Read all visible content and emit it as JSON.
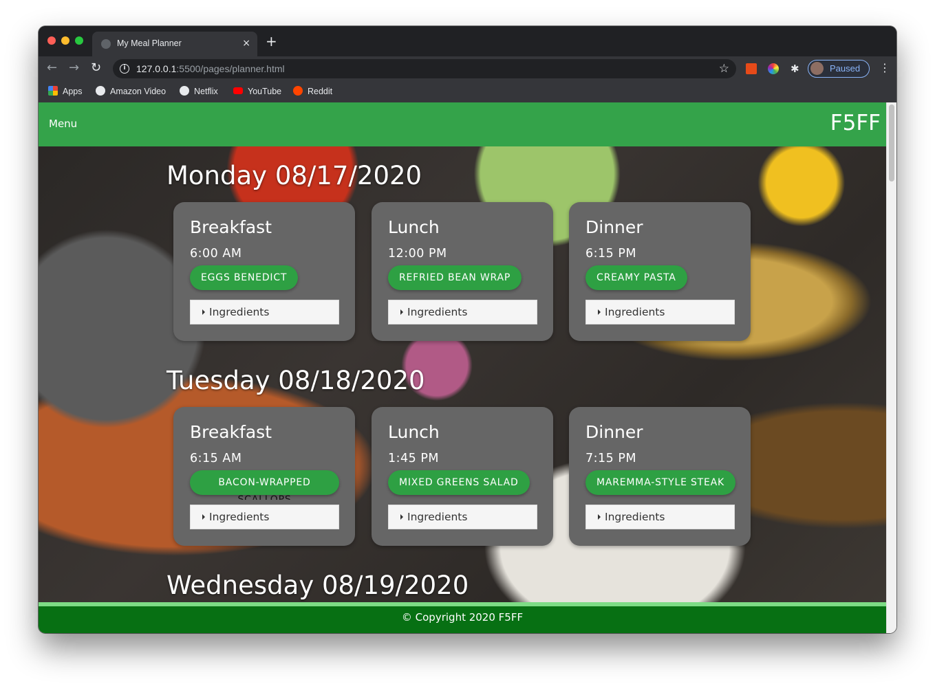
{
  "browser": {
    "tab_title": "My Meal Planner",
    "tab_close": "×",
    "new_tab": "+",
    "url_host": "127.0.0.1",
    "url_rest": ":5500/pages/planner.html",
    "profile_label": "Paused",
    "bookmarks": [
      {
        "label": "Apps",
        "icon": "apps-icon"
      },
      {
        "label": "Amazon Video",
        "icon": "globe-icon"
      },
      {
        "label": "Netflix",
        "icon": "globe-icon"
      },
      {
        "label": "YouTube",
        "icon": "youtube-icon"
      },
      {
        "label": "Reddit",
        "icon": "reddit-icon"
      }
    ]
  },
  "header": {
    "menu_label": "Menu",
    "brand": "F5FF"
  },
  "days": [
    {
      "heading": "Monday 08/17/2020",
      "meals": [
        {
          "name": "Breakfast",
          "time": "6:00 AM",
          "recipe": "EGGS BENEDICT",
          "ingredients": "Ingredients"
        },
        {
          "name": "Lunch",
          "time": "12:00 PM",
          "recipe": "REFRIED BEAN WRAP",
          "ingredients": "Ingredients"
        },
        {
          "name": "Dinner",
          "time": "6:15 PM",
          "recipe": "CREAMY PASTA",
          "ingredients": "Ingredients"
        }
      ]
    },
    {
      "heading": "Tuesday 08/18/2020",
      "meals": [
        {
          "name": "Breakfast",
          "time": "6:15 AM",
          "recipe": "BACON-WRAPPED",
          "recipe_overflow": "SCALLOPS",
          "ingredients": "Ingredients"
        },
        {
          "name": "Lunch",
          "time": "1:45 PM",
          "recipe": "MIXED GREENS SALAD",
          "ingredients": "Ingredients"
        },
        {
          "name": "Dinner",
          "time": "7:15 PM",
          "recipe": "MAREMMA-STYLE STEAK",
          "ingredients": "Ingredients"
        }
      ]
    },
    {
      "heading": "Wednesday 08/19/2020"
    }
  ],
  "footer": {
    "copyright": "© Copyright 2020 F5FF"
  },
  "colors": {
    "header_green": "#34a34a",
    "button_green": "#2ea043",
    "footer_green": "#077013",
    "card_gray": "#666666"
  }
}
